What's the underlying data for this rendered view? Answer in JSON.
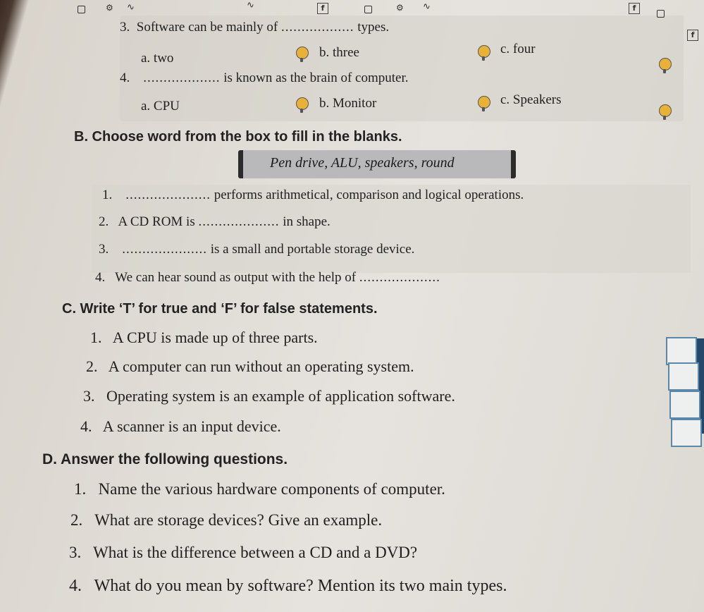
{
  "icons": [
    "box-icon",
    "gear-icon",
    "wave-icon",
    "f-icon",
    "box-icon",
    "gear-icon",
    "wave-icon",
    "f-icon",
    "box-icon",
    "f-icon"
  ],
  "section_a": {
    "q3": {
      "number": "3.",
      "text": "Software can be mainly of",
      "blank": "..................",
      "after": "types.",
      "options": [
        "a. two",
        "b. three",
        "c. four"
      ]
    },
    "q4": {
      "number": "4.",
      "blank": "...................",
      "text": "is known as the brain of computer.",
      "options": [
        "a. CPU",
        "b. Monitor",
        "c. Speakers"
      ]
    }
  },
  "section_b": {
    "heading": "B.   Choose word from the box to fill in the blanks.",
    "word_box": "Pen drive, ALU, speakers, round",
    "items": [
      {
        "number": "1.",
        "blank": ".....................",
        "text": "performs arithmetical, comparison and logical operations."
      },
      {
        "number": "2.",
        "text": "A CD ROM is",
        "blank": "....................",
        "after": "in shape."
      },
      {
        "number": "3.",
        "blank": ".....................",
        "text": "is a small and portable storage device."
      },
      {
        "number": "4.",
        "text": "We can hear sound as output with the help of",
        "blank": "...................."
      }
    ]
  },
  "section_c": {
    "heading": "C.   Write ‘T’ for true and ‘F’ for false statements.",
    "items": [
      {
        "number": "1.",
        "text": "A CPU is made up of three parts."
      },
      {
        "number": "2.",
        "text": "A computer can run without an operating system."
      },
      {
        "number": "3.",
        "text": "Operating system is an example of application software."
      },
      {
        "number": "4.",
        "text": "A scanner is an input device."
      }
    ]
  },
  "section_d": {
    "heading": "D.   Answer the following questions.",
    "items": [
      {
        "number": "1.",
        "text": "Name the various hardware components of computer."
      },
      {
        "number": "2.",
        "text": "What are storage devices? Give an example."
      },
      {
        "number": "3.",
        "text": "What is the difference between a CD and a DVD?"
      },
      {
        "number": "4.",
        "text": "What do you mean by software? Mention its two main types."
      }
    ]
  }
}
